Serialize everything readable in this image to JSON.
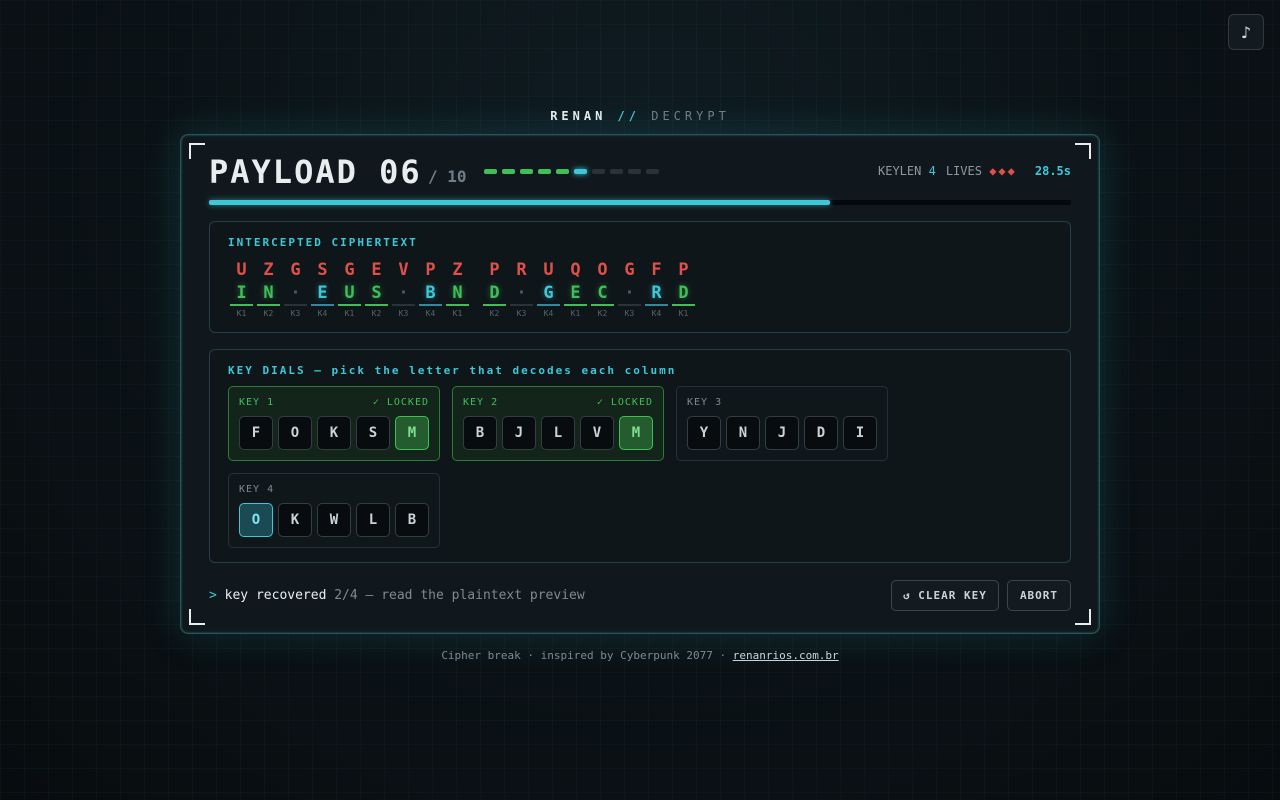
{
  "brand": {
    "name": "RENAN",
    "sep": "//",
    "mode": "DECRYPT"
  },
  "music": {
    "icon": "music-note-icon",
    "glyph": "♪"
  },
  "header": {
    "title": "PAYLOAD 06",
    "total": "/ 10",
    "payloads_total": 10,
    "payloads_done": 5,
    "current_payload": 6,
    "keylen_label": "KEYLEN",
    "keylen": "4",
    "lives_label": "LIVES",
    "lives": "◆◆◆",
    "timer": "28.5s",
    "progress_fraction": 0.72
  },
  "cipher": {
    "label": "INTERCEPTED CIPHERTEXT",
    "columns": [
      {
        "c": "U",
        "p": "I",
        "k": "K1",
        "s": "green"
      },
      {
        "c": "Z",
        "p": "N",
        "k": "K2",
        "s": "green"
      },
      {
        "c": "G",
        "p": "·",
        "k": "K3",
        "s": "dim"
      },
      {
        "c": "S",
        "p": "E",
        "k": "K4",
        "s": "cyan"
      },
      {
        "c": "G",
        "p": "U",
        "k": "K1",
        "s": "green"
      },
      {
        "c": "E",
        "p": "S",
        "k": "K2",
        "s": "green"
      },
      {
        "c": "V",
        "p": "·",
        "k": "K3",
        "s": "dim"
      },
      {
        "c": "P",
        "p": "B",
        "k": "K4",
        "s": "cyan"
      },
      {
        "c": "Z",
        "p": "N",
        "k": "K1",
        "s": "green"
      },
      {
        "gap": true
      },
      {
        "c": "P",
        "p": "D",
        "k": "K2",
        "s": "green"
      },
      {
        "c": "R",
        "p": "·",
        "k": "K3",
        "s": "dim"
      },
      {
        "c": "U",
        "p": "G",
        "k": "K4",
        "s": "cyan"
      },
      {
        "c": "Q",
        "p": "E",
        "k": "K1",
        "s": "green"
      },
      {
        "c": "O",
        "p": "C",
        "k": "K2",
        "s": "green"
      },
      {
        "c": "G",
        "p": "·",
        "k": "K3",
        "s": "dim"
      },
      {
        "c": "F",
        "p": "R",
        "k": "K4",
        "s": "cyan"
      },
      {
        "c": "P",
        "p": "D",
        "k": "K1",
        "s": "green"
      }
    ]
  },
  "dials": {
    "label": "KEY DIALS — pick the letter that decodes each column",
    "items": [
      {
        "name": "KEY 1",
        "status": "✓ LOCKED",
        "locked": true,
        "letters": [
          "F",
          "O",
          "K",
          "S",
          "M"
        ],
        "selected": 4,
        "sel": "green"
      },
      {
        "name": "KEY 2",
        "status": "✓ LOCKED",
        "locked": true,
        "letters": [
          "B",
          "J",
          "L",
          "V",
          "M"
        ],
        "selected": 4,
        "sel": "green"
      },
      {
        "name": "KEY 3",
        "status": "",
        "locked": false,
        "letters": [
          "Y",
          "N",
          "J",
          "D",
          "I"
        ],
        "selected": -1,
        "sel": ""
      },
      {
        "name": "KEY 4",
        "status": "",
        "locked": false,
        "letters": [
          "O",
          "K",
          "W",
          "L",
          "B"
        ],
        "selected": 0,
        "sel": "cyan"
      }
    ]
  },
  "console": {
    "prompt": ">",
    "lead": "key recovered",
    "count": "2/4",
    "rest": "— read the plaintext preview"
  },
  "actions": {
    "clear_label": "↺ CLEAR KEY",
    "abort_label": "ABORT"
  },
  "footer": {
    "text": "Cipher break · inspired by Cyberpunk 2077 ·",
    "link": "renanrios.com.br"
  },
  "colors": {
    "accent": "#3ec7d6",
    "success": "#3fbf58",
    "danger": "#e0504a"
  }
}
